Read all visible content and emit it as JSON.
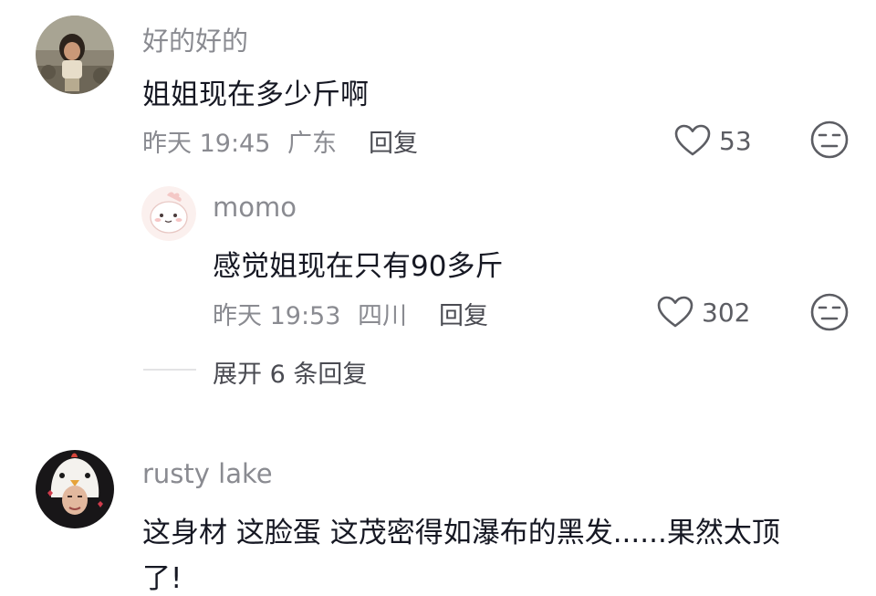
{
  "comments": [
    {
      "username": "好的好的",
      "text": "姐姐现在多少斤啊",
      "time": "昨天 19:45",
      "location": "广东",
      "reply_label": "回复",
      "likes": "53",
      "avatar_icon": "child-photo-avatar",
      "replies": [
        {
          "username": "momo",
          "text": "感觉姐现在只有90多斤",
          "time": "昨天 19:53",
          "location": "四川",
          "reply_label": "回复",
          "likes": "302",
          "avatar_icon": "cartoon-dinosaur-avatar"
        }
      ],
      "expand_label": "展开 6 条回复"
    },
    {
      "username": "rusty lake",
      "text_line1": "这身材 这脸蛋 这茂密得如瀑布的黑发......果然太顶",
      "text_line2": "了!",
      "avatar_icon": "person-in-chicken-hat-avatar"
    }
  ],
  "colors": {
    "primary_text": "#161823",
    "secondary_text": "#8a8b91",
    "divider": "#e3e3e5"
  }
}
